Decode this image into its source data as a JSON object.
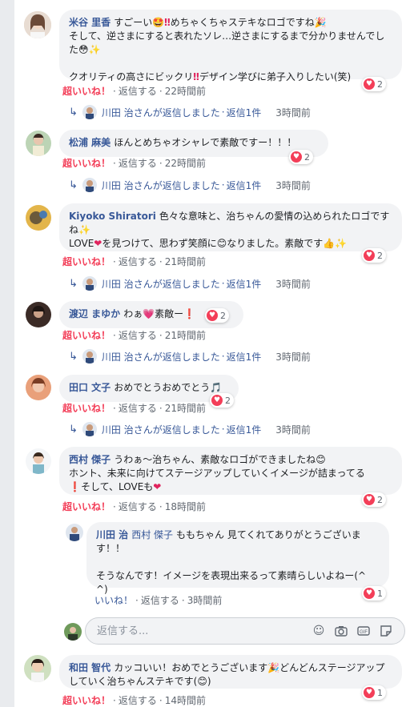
{
  "comments": [
    {
      "name": "米谷 里香",
      "text1": "すごーい",
      "text2": "めちゃくちゃステキなロゴですね",
      "text3": "そして、逆さまにすると表れたソレ…逆さまにするまで分かりませんでした",
      "text4": "クオリティの高さにビックリ",
      "text5": "デザイン学びに弟子入りしたい(笑)",
      "reactions": "2",
      "like_label": "超いいね！",
      "reply_label": "返信する",
      "time": "22時間前",
      "thread": {
        "text": "川田 治さんが返信しました",
        "count": "返信1件",
        "time": "3時間前"
      }
    },
    {
      "name": "松浦 麻美",
      "text1": "ほんとめちゃオシャレで素敵ですー！！！",
      "reactions": "2",
      "like_label": "超いいね！",
      "reply_label": "返信する",
      "time": "22時間前",
      "thread": {
        "text": "川田 治さんが返信しました",
        "count": "返信1件",
        "time": "3時間前"
      }
    },
    {
      "name": "Kiyoko Shiratori",
      "text1": "色々な意味と、治ちゃんの愛情の込められたロゴですね",
      "text2": "LOVE",
      "text3": "を見つけて、思わず笑顔に",
      "text4": "なりました。素敵です",
      "reactions": "2",
      "like_label": "超いいね！",
      "reply_label": "返信する",
      "time": "21時間前",
      "thread": {
        "text": "川田 治さんが返信しました",
        "count": "返信1件",
        "time": "3時間前"
      }
    },
    {
      "name": "渡辺 まゆか",
      "text1": "わぁ",
      "text2": "素敵ー",
      "reactions": "2",
      "like_label": "超いいね！",
      "reply_label": "返信する",
      "time": "21時間前",
      "thread": {
        "text": "川田 治さんが返信しました",
        "count": "返信1件",
        "time": "3時間前"
      }
    },
    {
      "name": "田口 文子",
      "text1": "おめでとうおめでとう",
      "reactions": "2",
      "like_label": "超いいね！",
      "reply_label": "返信する",
      "time": "21時間前",
      "thread": {
        "text": "川田 治さんが返信しました",
        "count": "返信1件",
        "time": "3時間前"
      }
    },
    {
      "name": "西村 �US子",
      "text1": "うわぁ〜治ちゃん、素敵なロゴができましたね",
      "text2": "ホント、未来に向けてステージアップしていくイメージが詰まってる",
      "text3": "そして、LOVEも",
      "reactions": "2",
      "like_label": "超いいね！",
      "reply_label": "返信する",
      "time": "18時間前"
    },
    {
      "name": "和田 智代",
      "text1": "カッコいい！おめでとうございます",
      "text2": "どんどんステージアップしていく治ちゃんステキです(",
      "text3": ")",
      "reactions": "1",
      "like_label": "超いいね！",
      "reply_label": "返信する",
      "time": "14時間前"
    }
  ],
  "reply": {
    "name": "川田 治",
    "tag": "西村 傑子",
    "text1": "ももちゃん 見てくれてありがとうございます！！",
    "text2": "そうなんです！イメージを表現出来るって素晴らしいよねー(^ ^)",
    "reactions": "1",
    "like_label": "いいね！",
    "reply_label": "返信する",
    "time": "3時間前"
  },
  "reply_input": {
    "placeholder": "返信する..."
  },
  "colors": {
    "link": "#385898",
    "love": "#f33e58",
    "bubble": "#f2f3f5"
  }
}
